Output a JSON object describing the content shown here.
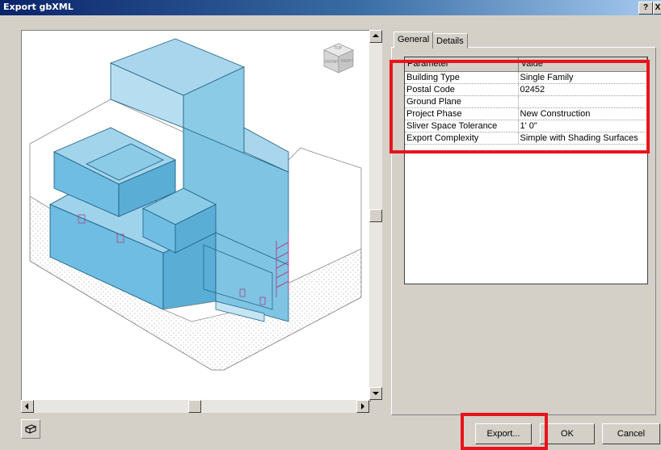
{
  "window": {
    "title": "Export gbXML",
    "help_label": "?",
    "close_label": "X"
  },
  "viewcube": {
    "top_label": "TOP",
    "front_label": "FRONT",
    "right_label": "RIGHT"
  },
  "tabs": [
    {
      "label": "General",
      "active": true
    },
    {
      "label": "Details",
      "active": false
    }
  ],
  "grid": {
    "columns": [
      "Parameter",
      "Value"
    ],
    "rows": [
      {
        "parameter": "Building Type",
        "value": "Single Family"
      },
      {
        "parameter": "Postal Code",
        "value": "02452"
      },
      {
        "parameter": "Ground Plane",
        "value": ""
      },
      {
        "parameter": "Project Phase",
        "value": "New Construction"
      },
      {
        "parameter": "Sliver Space Tolerance",
        "value": "1'  0\""
      },
      {
        "parameter": "Export Complexity",
        "value": "Simple with Shading Surfaces"
      }
    ]
  },
  "buttons": {
    "export": "Export...",
    "ok": "OK",
    "cancel": "Cancel"
  },
  "colors": {
    "highlight": "#e8141c",
    "model_fill": "#5eb8e0",
    "title_bar": "#0a246a"
  }
}
